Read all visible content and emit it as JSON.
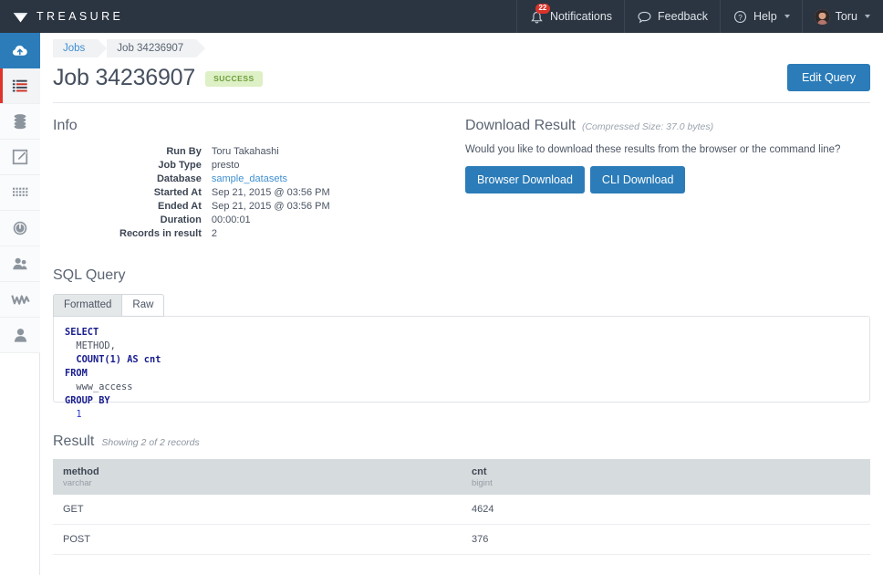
{
  "topbar": {
    "brand": "TREASURE",
    "logo_icon": "diamond-gem-icon",
    "nav": [
      {
        "label": "Notifications",
        "icon": "bell-icon",
        "badge": "22"
      },
      {
        "label": "Feedback",
        "icon": "speech-bubble-icon"
      },
      {
        "label": "Help",
        "icon": "question-circle-icon",
        "caret": true
      },
      {
        "label": "Toru",
        "icon": "avatar-photo",
        "caret": true
      }
    ]
  },
  "sidebar": {
    "items": [
      {
        "name": "data-upload",
        "icon": "cloud-upload-icon",
        "state": "active"
      },
      {
        "name": "jobs",
        "icon": "list-icon",
        "state": "current"
      },
      {
        "name": "databases",
        "icon": "database-stack-icon",
        "state": "normal"
      },
      {
        "name": "new-query",
        "icon": "pencil-edit-icon",
        "state": "normal"
      },
      {
        "name": "apps",
        "icon": "grid-apps-icon",
        "state": "normal"
      },
      {
        "name": "monitoring",
        "icon": "gauge-icon",
        "state": "normal"
      },
      {
        "name": "users",
        "icon": "users-group-icon",
        "state": "normal"
      },
      {
        "name": "analytics",
        "icon": "chart-line-icon",
        "state": "normal"
      },
      {
        "name": "profile",
        "icon": "person-icon",
        "state": "normal"
      }
    ]
  },
  "breadcrumb": {
    "jobs": "Jobs",
    "current": "Job 34236907"
  },
  "page": {
    "title": "Job 34236907",
    "status": "SUCCESS",
    "edit_button": "Edit Query"
  },
  "info": {
    "heading": "Info",
    "rows": [
      {
        "label": "Run By",
        "value": "Toru Takahashi",
        "link": false
      },
      {
        "label": "Job Type",
        "value": "presto",
        "link": false
      },
      {
        "label": "Database",
        "value": "sample_datasets",
        "link": true
      },
      {
        "label": "Started At",
        "value": "Sep 21, 2015 @ 03:56 PM",
        "link": false
      },
      {
        "label": "Ended At",
        "value": "Sep 21, 2015 @ 03:56 PM",
        "link": false
      },
      {
        "label": "Duration",
        "value": "00:00:01",
        "link": false
      },
      {
        "label": "Records in result",
        "value": "2",
        "link": false
      }
    ]
  },
  "download": {
    "heading": "Download Result",
    "size_note": "(Compressed Size: 37.0 bytes)",
    "question": "Would you like to download these results from the browser or the command line?",
    "browser_button": "Browser Download",
    "cli_button": "CLI Download"
  },
  "sql": {
    "heading": "SQL Query",
    "tabs": [
      {
        "label": "Formatted",
        "active": true
      },
      {
        "label": "Raw",
        "active": false
      }
    ],
    "query_lines": [
      {
        "text": "SELECT",
        "type": "kw"
      },
      {
        "text": "  METHOD,",
        "type": "plain"
      },
      {
        "text": "  COUNT(1) AS cnt",
        "type": "mixed"
      },
      {
        "text": "FROM",
        "type": "kw"
      },
      {
        "text": "  www_access",
        "type": "plain"
      },
      {
        "text": "GROUP BY",
        "type": "kw"
      },
      {
        "text": "  1",
        "type": "num"
      }
    ],
    "query_raw": "SELECT\n  METHOD,\n  COUNT(1) AS cnt\nFROM\n  www_access\nGROUP BY\n  1"
  },
  "result": {
    "heading": "Result",
    "showing": "Showing 2 of 2 records",
    "columns": [
      {
        "name": "method",
        "type": "varchar"
      },
      {
        "name": "cnt",
        "type": "bigint"
      }
    ],
    "rows": [
      {
        "method": "GET",
        "cnt": "4624"
      },
      {
        "method": "POST",
        "cnt": "376"
      }
    ]
  },
  "colors": {
    "header_bg": "#2b3441",
    "accent_blue": "#2b7cb9",
    "link_blue": "#3f8fd0",
    "success_bg": "#ddf0c6",
    "success_text": "#6f9e3b",
    "badge_red": "#d9342b",
    "table_header_bg": "#d6dbdd"
  }
}
